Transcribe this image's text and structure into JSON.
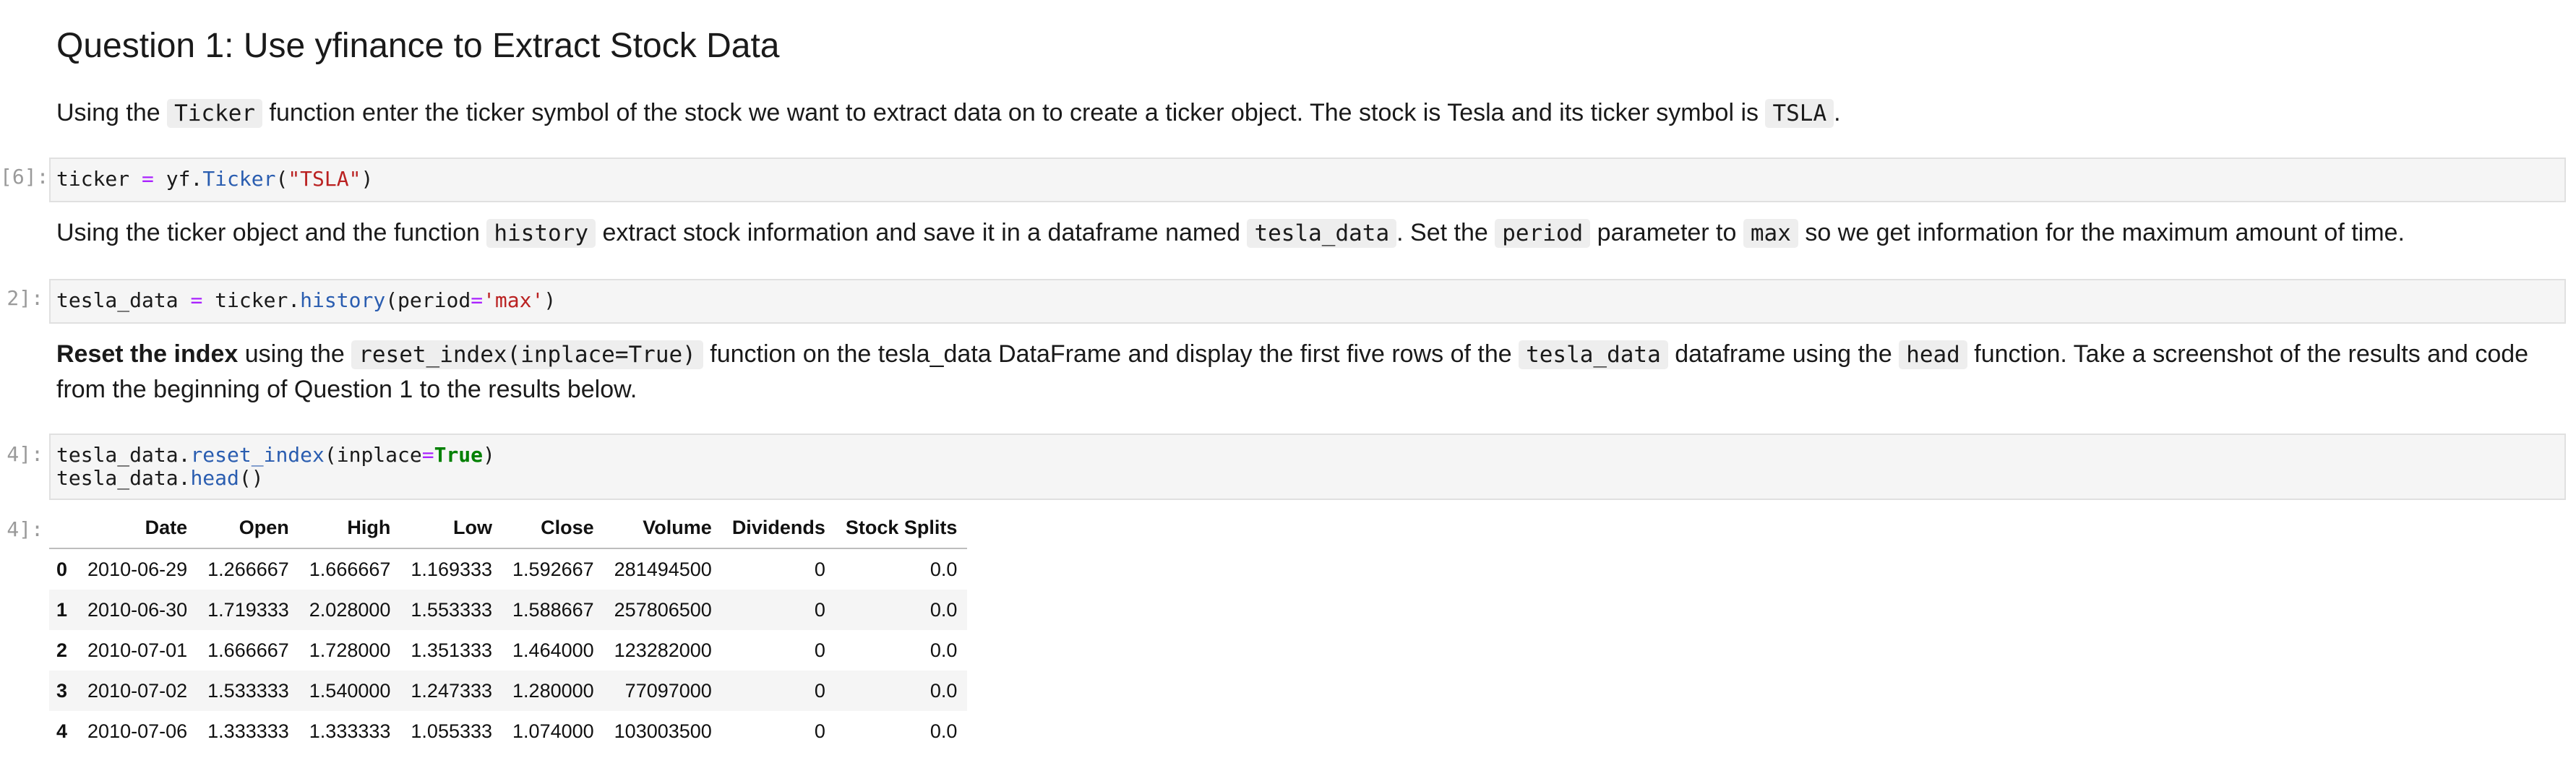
{
  "heading": "Question 1: Use yfinance to Extract Stock Data",
  "para1": {
    "t1": "Using the",
    "c1": "Ticker",
    "t2": "function enter the ticker symbol of the stock we want to extract data on to create a ticker object. The stock is Tesla and its ticker symbol is",
    "c2": "TSLA",
    "t3": "."
  },
  "cell1": {
    "prompt": "[6]:",
    "var": "ticker",
    "eq": "=",
    "obj": "yf.",
    "fn": "Ticker",
    "open": "(",
    "arg": "\"TSLA\"",
    "close": ")"
  },
  "para2": {
    "t1": "Using the ticker object and the function",
    "c1": "history",
    "t2": "extract stock information and save it in a dataframe named",
    "c2": "tesla_data",
    "t3": ". Set the",
    "c3": "period",
    "t4": "parameter to",
    "c4": "max",
    "t5": "so we get information for the maximum amount of time."
  },
  "cell2": {
    "prompt": "2]:",
    "var": "tesla_data",
    "eq": "=",
    "obj": "ticker.",
    "fn": "history",
    "open": "(period",
    "eq2": "=",
    "arg": "'max'",
    "close": ")"
  },
  "para3": {
    "bold": "Reset the index",
    "t1": "using the",
    "c1": "reset_index(inplace=True)",
    "t2": "function on the tesla_data DataFrame and display the first five rows of the",
    "c2": "tesla_data",
    "t3": "dataframe using the",
    "c3": "head",
    "t4": "function. Take a screenshot of the results and code from the beginning of Question 1 to the results below."
  },
  "cell3": {
    "prompt": "4]:",
    "l1_obj": "tesla_data.",
    "l1_fn": "reset_index",
    "l1_open": "(inplace",
    "l1_eq": "=",
    "l1_kw": "True",
    "l1_close": ")",
    "l2_obj": "tesla_data.",
    "l2_fn": "head",
    "l2_close": "()"
  },
  "output": {
    "prompt": "4]:",
    "columns": [
      "",
      "Date",
      "Open",
      "High",
      "Low",
      "Close",
      "Volume",
      "Dividends",
      "Stock Splits"
    ],
    "rows": [
      [
        "0",
        "2010-06-29",
        "1.266667",
        "1.666667",
        "1.169333",
        "1.592667",
        "281494500",
        "0",
        "0.0"
      ],
      [
        "1",
        "2010-06-30",
        "1.719333",
        "2.028000",
        "1.553333",
        "1.588667",
        "257806500",
        "0",
        "0.0"
      ],
      [
        "2",
        "2010-07-01",
        "1.666667",
        "1.728000",
        "1.351333",
        "1.464000",
        "123282000",
        "0",
        "0.0"
      ],
      [
        "3",
        "2010-07-02",
        "1.533333",
        "1.540000",
        "1.247333",
        "1.280000",
        "77097000",
        "0",
        "0.0"
      ],
      [
        "4",
        "2010-07-06",
        "1.333333",
        "1.333333",
        "1.055333",
        "1.074000",
        "103003500",
        "0",
        "0.0"
      ]
    ]
  }
}
